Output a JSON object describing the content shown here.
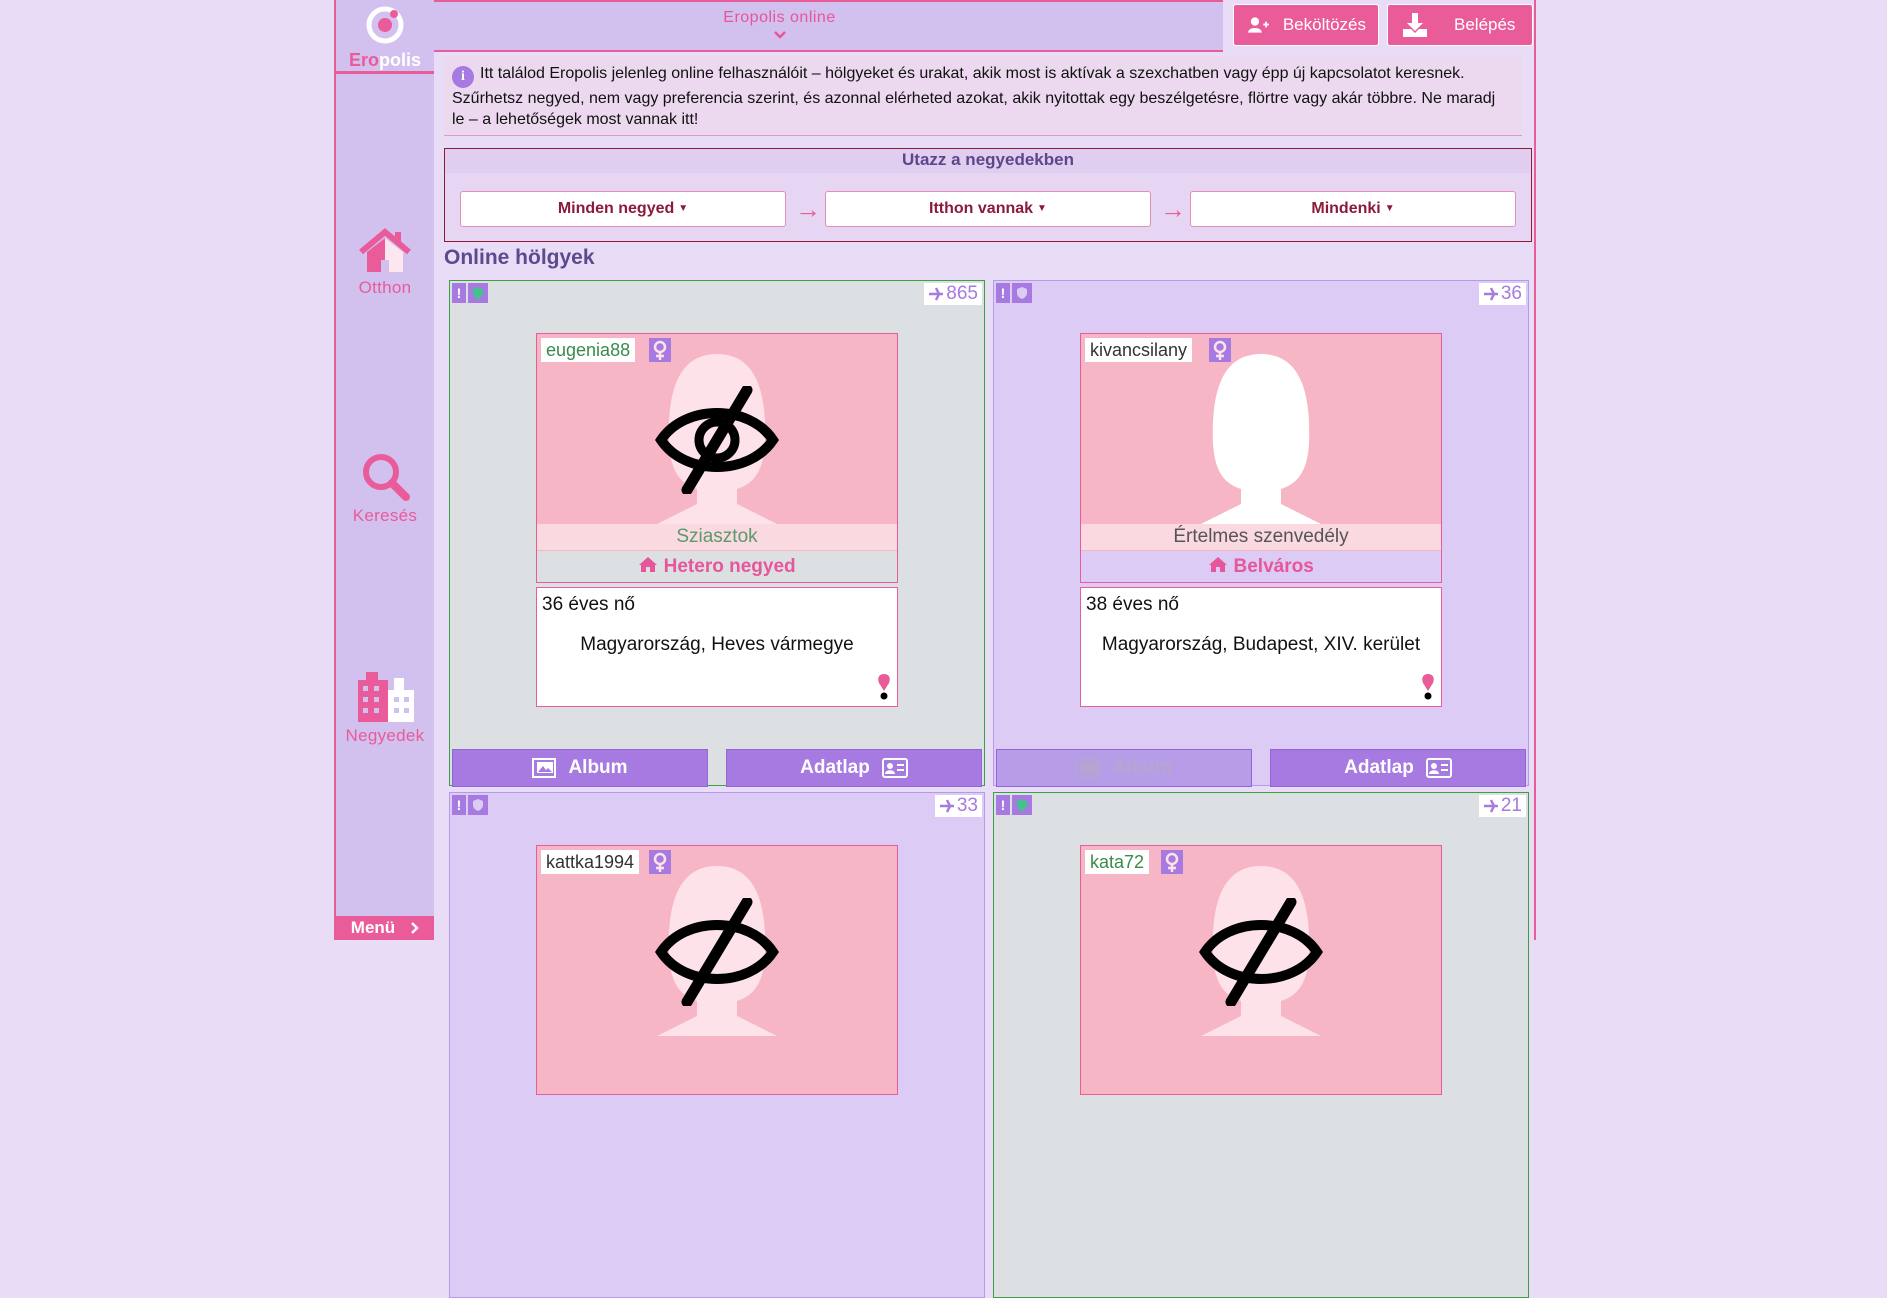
{
  "header": {
    "online_title": "Eropolis online",
    "move_in_label": "Beköltözés",
    "login_label": "Belépés"
  },
  "logo": {
    "part1": "Ero",
    "part2": "polis"
  },
  "sidebar": {
    "items": [
      {
        "label": "Otthon",
        "icon": "home-icon"
      },
      {
        "label": "Keresés",
        "icon": "search-icon"
      },
      {
        "label": "Negyedek",
        "icon": "buildings-icon"
      }
    ],
    "menu_label": "Menü"
  },
  "info": {
    "text": "Itt találod Eropolis jelenleg online felhasználóit – hölgyeket és urakat, akik most is aktívak a szexchatben vagy épp új kapcsolatot keresnek. Szűrhetsz negyed, nem vagy preferencia szerint, és azonnal elérheted azokat, akik nyitottak egy beszélgetésre, flörtre vagy akár többre. Ne maradj le – a lehetőségek most vannak itt!"
  },
  "travel": {
    "title": "Utazz a negyedekben",
    "selects": [
      "Minden negyed",
      "Itthon vannak",
      "Mindenki"
    ],
    "arrow": "→"
  },
  "section_title": "Online hölgyek",
  "cards": [
    {
      "count": "865",
      "username": "eugenia88",
      "motto": "Sziasztok",
      "district": "Hetero negyed",
      "age": "36 éves nő",
      "location": "Magyarország, Heves vármegye",
      "album": "Album",
      "profile": "Adatlap"
    },
    {
      "count": "36",
      "username": "kivancsilany",
      "motto": "Értelmes szenvedély",
      "district": "Belváros",
      "age": "38 éves nő",
      "location": "Magyarország, Budapest, XIV. kerület",
      "album": "Album",
      "profile": "Adatlap"
    },
    {
      "count": "33",
      "username": "kattka1994"
    },
    {
      "count": "21",
      "username": "kata72"
    }
  ],
  "colors": {
    "accent": "#ea5b9a",
    "purple": "#a67ae0",
    "lavender": "#d2c0ef",
    "green_border": "#3aa042"
  }
}
